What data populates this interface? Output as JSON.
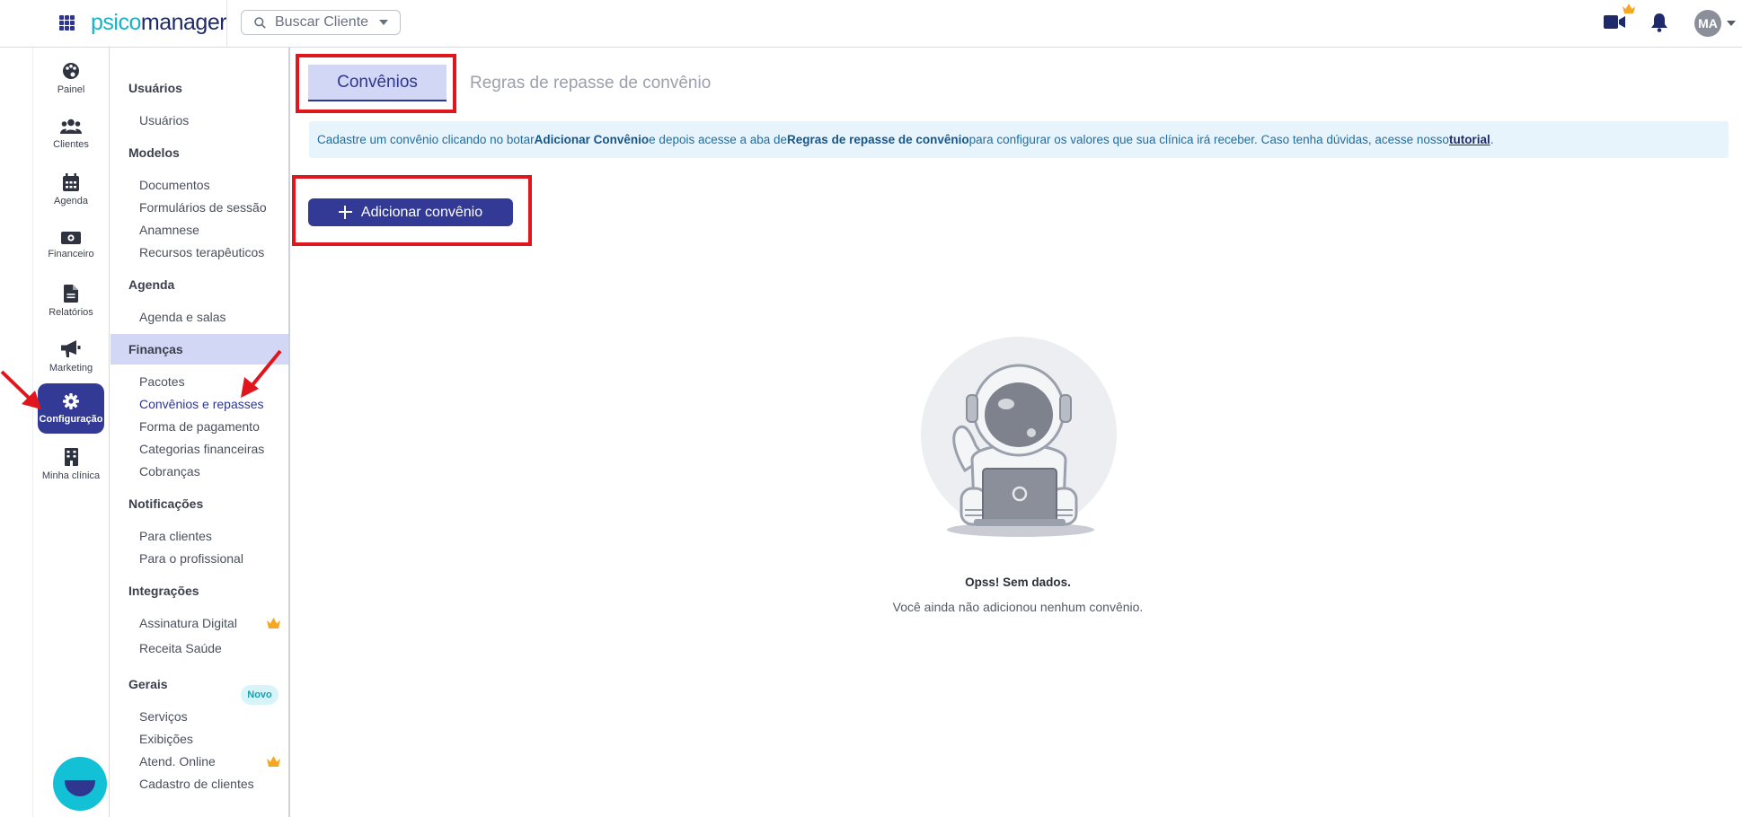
{
  "topbar": {
    "logo_part1": "psico",
    "logo_part2": "manager",
    "search_label": "Buscar Cliente",
    "avatar_initials": "MA"
  },
  "rail": {
    "items": [
      {
        "label": "Painel",
        "icon": "palette-icon"
      },
      {
        "label": "Clientes",
        "icon": "users-icon"
      },
      {
        "label": "Agenda",
        "icon": "calendar-icon"
      },
      {
        "label": "Financeiro",
        "icon": "money-icon"
      },
      {
        "label": "Relatórios",
        "icon": "document-icon"
      },
      {
        "label": "Marketing",
        "icon": "megaphone-icon"
      },
      {
        "label": "Configuração",
        "icon": "gear-icon",
        "active": true
      },
      {
        "label": "Minha clínica",
        "icon": "building-icon"
      }
    ]
  },
  "settings": {
    "groups": {
      "usuarios": "Usuários",
      "modelos": "Modelos",
      "agenda": "Agenda",
      "financas": "Finanças",
      "notificacoes": "Notificações",
      "integracoes": "Integrações",
      "gerais": "Gerais"
    },
    "items": {
      "usuarios": "Usuários",
      "documentos": "Documentos",
      "formularios": "Formulários de sessão",
      "anamnese": "Anamnese",
      "recursos": "Recursos terapêuticos",
      "agenda_salas": "Agenda e salas",
      "pacotes": "Pacotes",
      "convenios": "Convênios e repasses",
      "forma_pagamento": "Forma de pagamento",
      "categorias": "Categorias financeiras",
      "cobrancas": "Cobranças",
      "para_clientes": "Para clientes",
      "para_profissional": "Para o profissional",
      "assinatura": "Assinatura Digital",
      "receita": "Receita Saúde",
      "servicos": "Serviços",
      "exibicoes": "Exibições",
      "atend_online": "Atend. Online",
      "cadastro": "Cadastro de clientes"
    },
    "novo_badge": "Novo"
  },
  "main": {
    "tab_active": "Convênios",
    "tab_2": "Regras de repasse de convênio",
    "info": {
      "t1": "Cadastre um convênio clicando no botar ",
      "b1": "Adicionar Convênio",
      "t2": " e depois acesse a aba de ",
      "b2": "Regras de repasse de convênio",
      "t3": " para configurar os valores que sua clínica irá receber. Caso tenha dúvidas, acesse nosso ",
      "link": "tutorial",
      "t4": "."
    },
    "add_button": "Adicionar convênio",
    "empty_title": "Opss! Sem dados.",
    "empty_text": "Você ainda não adicionou nenhum convênio."
  },
  "colors": {
    "brand": "#2e3690",
    "accent": "#13c1d6",
    "highlight": "#e0161c"
  }
}
